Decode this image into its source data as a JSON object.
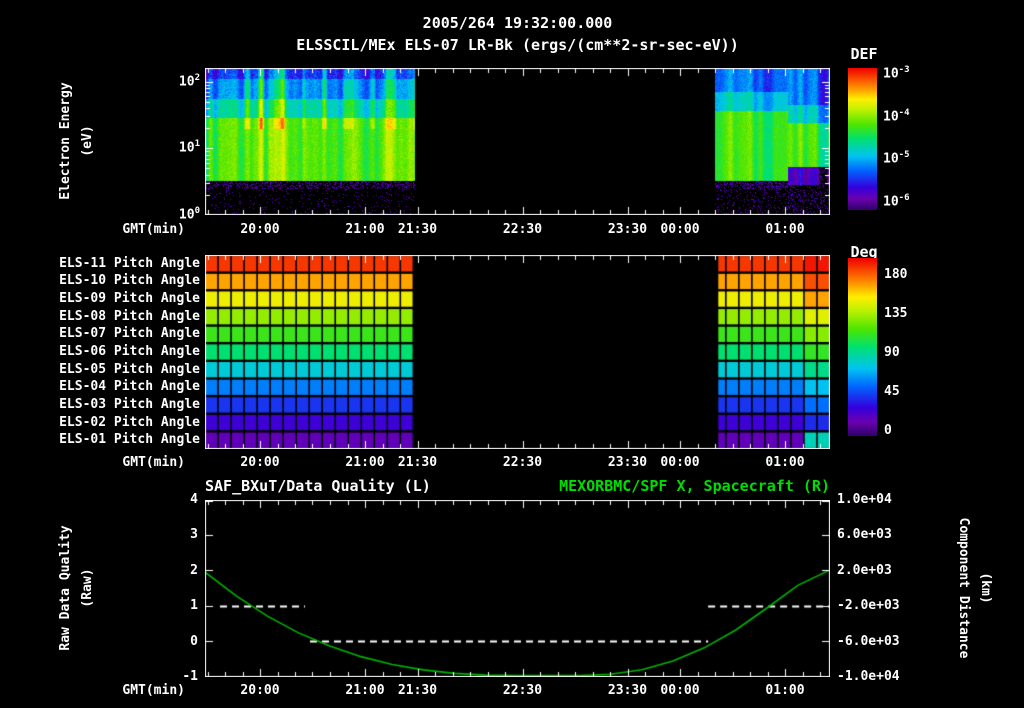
{
  "header": {
    "timestamp": "2005/264 19:32:00.000",
    "instrument_title": "ELSSCIL/MEx ELS-07 LR-Bk  (ergs/(cm**2-sr-sec-eV))"
  },
  "colors": {
    "background": "#000000",
    "foreground": "#ffffff",
    "title_green": "#00dd00"
  },
  "time_axis": {
    "label": "GMT(min)",
    "ticks": [
      {
        "label": "20:00",
        "frac": 0.088
      },
      {
        "label": "21:00",
        "frac": 0.256
      },
      {
        "label": "21:30",
        "frac": 0.34
      },
      {
        "label": "22:30",
        "frac": 0.508
      },
      {
        "label": "23:30",
        "frac": 0.676
      },
      {
        "label": "00:00",
        "frac": 0.76
      },
      {
        "label": "01:00",
        "frac": 0.928
      }
    ],
    "minor_tick_step_frac": 0.028,
    "minor_tick_origin_frac": 0.004
  },
  "colormap": [
    {
      "pos": 0.0,
      "hex": "#30006a"
    },
    {
      "pos": 0.08,
      "hex": "#6a00b0"
    },
    {
      "pos": 0.16,
      "hex": "#3300dd"
    },
    {
      "pos": 0.28,
      "hex": "#0066ff"
    },
    {
      "pos": 0.38,
      "hex": "#00c4f0"
    },
    {
      "pos": 0.5,
      "hex": "#00e070"
    },
    {
      "pos": 0.6,
      "hex": "#4ce600"
    },
    {
      "pos": 0.7,
      "hex": "#b8f000"
    },
    {
      "pos": 0.78,
      "hex": "#ffee00"
    },
    {
      "pos": 0.88,
      "hex": "#ff7a00"
    },
    {
      "pos": 1.0,
      "hex": "#ef0000"
    }
  ],
  "chart_data": [
    {
      "type": "heatmap",
      "name": "electron-energy-spectrogram",
      "ylabel": "Electron Energy",
      "ylabel_units": "(eV)",
      "yscale": "log",
      "ylim_ev": [
        1,
        160
      ],
      "xlabel": "GMT(min)",
      "xticklabels": [
        "20:00",
        "21:00",
        "21:30",
        "22:30",
        "23:30",
        "00:00",
        "01:00"
      ],
      "ytick_exponents": [
        {
          "base": "10",
          "exp": "2"
        },
        {
          "base": "10",
          "exp": "1"
        },
        {
          "base": "10",
          "exp": "0"
        }
      ],
      "colorbar": {
        "title": "DEF",
        "ticks": [
          {
            "base": "10",
            "exp": "-3",
            "frac": 0.042
          },
          {
            "base": "10",
            "exp": "-4",
            "frac": 0.343
          },
          {
            "base": "10",
            "exp": "-5",
            "frac": 0.643
          },
          {
            "base": "10",
            "exp": "-6",
            "frac": 0.944
          }
        ]
      },
      "segments": [
        {
          "range": [
            0.0,
            0.336
          ],
          "profile": "main",
          "streaks": true
        },
        {
          "range": [
            0.816,
            0.932
          ],
          "profile": "right",
          "streaks": false
        },
        {
          "range": [
            0.932,
            1.0
          ],
          "profile": "right_end",
          "streaks": false
        }
      ],
      "profiles": {
        "main": [
          {
            "lo": 0.0,
            "hi": 0.4,
            "v": -1,
            "speckle": 0.05,
            "sv": 0.1
          },
          {
            "lo": 0.4,
            "hi": 0.52,
            "v": -1,
            "speckle": 0.3,
            "sv": 0.1
          },
          {
            "lo": 0.52,
            "hi": 1.46,
            "v": 0.6,
            "noise": 0.07
          },
          {
            "lo": 1.46,
            "hi": 1.74,
            "v": 0.44,
            "noise": 0.09
          },
          {
            "lo": 1.74,
            "hi": 2.04,
            "v": 0.32,
            "noise": 0.09
          },
          {
            "lo": 2.04,
            "hi": 2.21,
            "v": 0.22,
            "noise": 0.12,
            "speckle": 0.1,
            "sv": 0.09
          }
        ],
        "right": [
          {
            "lo": 0.0,
            "hi": 0.38,
            "v": -1,
            "speckle": 0.1,
            "sv": 0.1
          },
          {
            "lo": 0.38,
            "hi": 0.52,
            "v": -1,
            "speckle": 0.35,
            "sv": 0.11
          },
          {
            "lo": 0.52,
            "hi": 1.56,
            "v": 0.6,
            "noise": 0.06
          },
          {
            "lo": 1.56,
            "hi": 1.85,
            "v": 0.42,
            "noise": 0.08
          },
          {
            "lo": 1.85,
            "hi": 2.21,
            "v": 0.31,
            "noise": 0.08
          }
        ],
        "right_end": [
          {
            "lo": 0.0,
            "hi": 0.45,
            "v": -1,
            "speckle": 0.18,
            "sv": 0.11
          },
          {
            "lo": 0.45,
            "hi": 0.72,
            "v": 0.1,
            "noise": 0.08
          },
          {
            "lo": 0.72,
            "hi": 1.38,
            "v": 0.58,
            "noise": 0.06
          },
          {
            "lo": 1.38,
            "hi": 1.66,
            "v": 0.4,
            "noise": 0.08
          },
          {
            "lo": 1.66,
            "hi": 2.21,
            "v": 0.29,
            "noise": 0.08
          }
        ]
      }
    },
    {
      "type": "heatmap",
      "name": "pitch-angle-panel",
      "xlabel": "GMT(min)",
      "rows": [
        {
          "label": "ELS-11 Pitch Angle",
          "angle_deg": 170,
          "edge_angle_deg": 176
        },
        {
          "label": "ELS-10 Pitch Angle",
          "angle_deg": 152,
          "edge_angle_deg": 166
        },
        {
          "label": "ELS-09 Pitch Angle",
          "angle_deg": 137,
          "edge_angle_deg": 152
        },
        {
          "label": "ELS-08 Pitch Angle",
          "angle_deg": 120,
          "edge_angle_deg": 134
        },
        {
          "label": "ELS-07 Pitch Angle",
          "angle_deg": 104,
          "edge_angle_deg": 118
        },
        {
          "label": "ELS-06 Pitch Angle",
          "angle_deg": 90,
          "edge_angle_deg": 102
        },
        {
          "label": "ELS-05 Pitch Angle",
          "angle_deg": 73,
          "edge_angle_deg": 86
        },
        {
          "label": "ELS-04 Pitch Angle",
          "angle_deg": 55,
          "edge_angle_deg": 68
        },
        {
          "label": "ELS-03 Pitch Angle",
          "angle_deg": 40,
          "edge_angle_deg": 52
        },
        {
          "label": "ELS-02 Pitch Angle",
          "angle_deg": 26,
          "edge_angle_deg": 38
        },
        {
          "label": "ELS-01 Pitch Angle",
          "angle_deg": 17,
          "edge_angle_deg": 78
        }
      ],
      "segments_frac": [
        [
          0.0,
          0.336
        ],
        [
          0.82,
          1.0
        ]
      ],
      "cells": 48,
      "edge_cells": 2,
      "colorbar": {
        "title": "Deg",
        "range_deg": [
          0,
          180
        ],
        "ticks": [
          {
            "label": "180",
            "frac": 0.096
          },
          {
            "label": "135",
            "frac": 0.315
          },
          {
            "label": "90",
            "frac": 0.534
          },
          {
            "label": "45",
            "frac": 0.753
          },
          {
            "label": "0",
            "frac": 0.972
          }
        ]
      }
    },
    {
      "type": "line",
      "name": "quality-and-distance",
      "title_left": "SAF_BXuT/Data Quality (L)",
      "title_right": "MEXORBMC/SPF X, Spacecraft (R)",
      "xlabel": "GMT(min)",
      "left_axis": {
        "label": "Raw Data Quality",
        "label_units": "(Raw)",
        "range": [
          -1,
          4
        ],
        "ticks": [
          4,
          3,
          2,
          1,
          0,
          -1
        ]
      },
      "right_axis": {
        "label": "Component Distance",
        "label_units": "(km)",
        "range": [
          -10000,
          10000
        ],
        "ticks": [
          {
            "label": "1.0e+04",
            "value": 10000
          },
          {
            "label": "6.0e+03",
            "value": 6000
          },
          {
            "label": "2.0e+03",
            "value": 2000
          },
          {
            "label": "-2.0e+03",
            "value": -2000
          },
          {
            "label": "-6.0e+03",
            "value": -6000
          },
          {
            "label": "-1.0e+04",
            "value": -10000
          }
        ]
      },
      "series": [
        {
          "name": "data-quality",
          "axis": "left",
          "style": "dashed",
          "color": "#ffffff",
          "segments": [
            {
              "value": 1,
              "frac": [
                0.024,
                0.16
              ]
            },
            {
              "value": 0,
              "frac": [
                0.168,
                0.805
              ]
            },
            {
              "value": 1,
              "frac": [
                0.805,
                1.0
              ]
            }
          ]
        },
        {
          "name": "spacecraft-x-distance",
          "axis": "right",
          "style": "solid",
          "color": "#00b400",
          "points": [
            [
              0.0,
              1800
            ],
            [
              0.05,
              -900
            ],
            [
              0.1,
              -3200
            ],
            [
              0.15,
              -5100
            ],
            [
              0.2,
              -6600
            ],
            [
              0.25,
              -7800
            ],
            [
              0.3,
              -8700
            ],
            [
              0.35,
              -9300
            ],
            [
              0.4,
              -9700
            ],
            [
              0.45,
              -9900
            ],
            [
              0.5,
              -10000
            ],
            [
              0.55,
              -10050
            ],
            [
              0.6,
              -10000
            ],
            [
              0.65,
              -9800
            ],
            [
              0.7,
              -9300
            ],
            [
              0.75,
              -8300
            ],
            [
              0.8,
              -6800
            ],
            [
              0.85,
              -4800
            ],
            [
              0.9,
              -2300
            ],
            [
              0.95,
              300
            ],
            [
              1.0,
              2000
            ]
          ]
        }
      ]
    }
  ]
}
